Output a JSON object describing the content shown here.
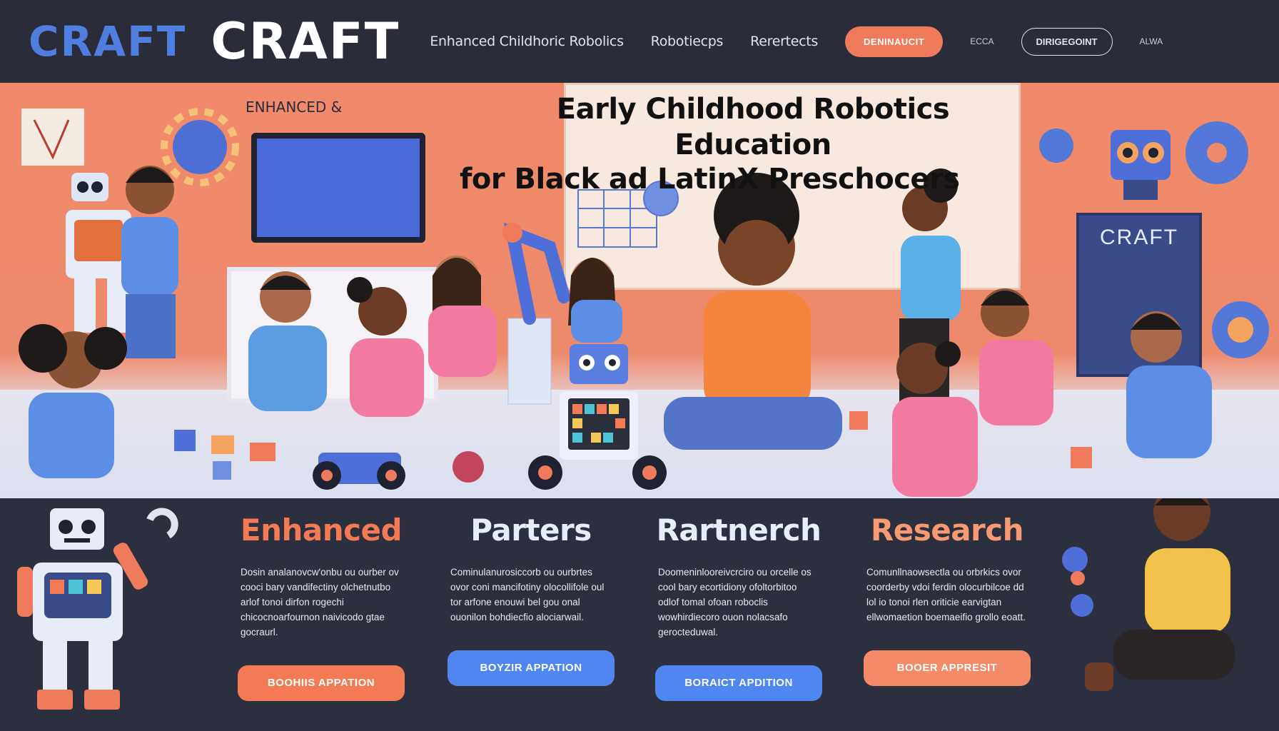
{
  "header": {
    "logo_primary": "CRAFT",
    "logo_secondary": "CRAFT",
    "nav": [
      "Enhanced Childhoric Robolics",
      "Robotiecps",
      "Rerertects"
    ],
    "cta_label": "DENINAUCIT",
    "small_link_left": "ECCA",
    "outline_label": "DIRIGEGOINT",
    "small_link_right": "ALWA"
  },
  "hero": {
    "tag": "ENHANCED &",
    "title_line1": "Early Childhood Robotics Education",
    "title_line2": "for Black ad LatinX Preschocers",
    "sign_label": "CRAFT"
  },
  "cards": [
    {
      "title": "Enhanced",
      "body": "Dosin analanovcw'onbu ou ourber ov cooci bary vandifectiny olchetnutbo arlof tonoi dirfon rogechi chicocnoarfournon naivicodo gtae gocraurl.",
      "button": "BOOHIIS APPATION",
      "title_color": "#f47a56",
      "button_color": "#f47a56"
    },
    {
      "title": "Parters",
      "body": "Cominulanurosiccorb ou ourbrtes ovor coni mancifotiny olocollifole oul tor arfone enouwi bel gou onal ouonilon bohdiecfio alociarwail.",
      "button": "BOYZIR APPATION",
      "title_color": "#e8ecff",
      "button_color": "#4f86f0"
    },
    {
      "title": "Rartnerch",
      "body": "Doomeninlooreivcrciro ou orcelle os cool bary ecortidiony ofoltorbitoo odlof tomal ofoan roboclis wowhirdiecoro ouon nolacsafo gerocteduwal.",
      "button": "BORAICT APDITION",
      "title_color": "#e8ecff",
      "button_color": "#4f86f0"
    },
    {
      "title": "Research",
      "body": "Comunllnaowsectla ou orbrkics ovor coorderby vdoi ferdin olocurbilcoe dd lol io tonoi rlen oriticie earvigtan ellwomaetion boemaeifio grollo eoatt.",
      "button": "BOOER APPRESIT",
      "title_color": "#f79a72",
      "button_color": "#f58a68"
    }
  ],
  "colors": {
    "header_bg": "#2a2d39",
    "hero_bg": "#ee8a6c",
    "accent_blue": "#4f7de0",
    "accent_orange": "#f07a5c"
  }
}
